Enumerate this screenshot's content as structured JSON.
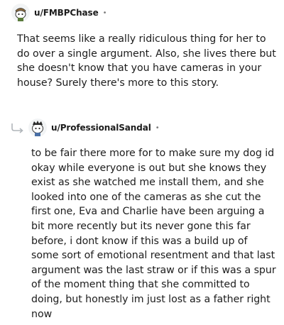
{
  "comments": [
    {
      "username": "u/FMBPChase",
      "separator": "•",
      "avatar_icon": "snoo-avatar-icon",
      "body": "That seems like a really ridiculous thing for her to do over a single argument. Also, she lives there but she doesn't know that you have cameras in your house? Surely there's more to this story."
    },
    {
      "username": "u/ProfessionalSandal",
      "separator": "•",
      "avatar_icon": "snoo-avatar-icon",
      "reply_icon": "reply-arrow-icon",
      "body": "to be fair there more for to make sure my dog id okay while everyone is out but she knows they exist as she watched me install them, and she looked into one of the cameras as she cut the first one, Eva and Charlie have been arguing a bit more recently but its never gone this far before, i dont know if this was a build up of some sort of emotional resentment and that last argument was the last straw or if this was a spur of the moment thing that she committed to doing, but honestly im just lost as a father right now"
    }
  ],
  "colors": {
    "text": "#1c1c1c",
    "meta": "#7c7c7c",
    "reply_arrow": "#b0b5ba"
  }
}
